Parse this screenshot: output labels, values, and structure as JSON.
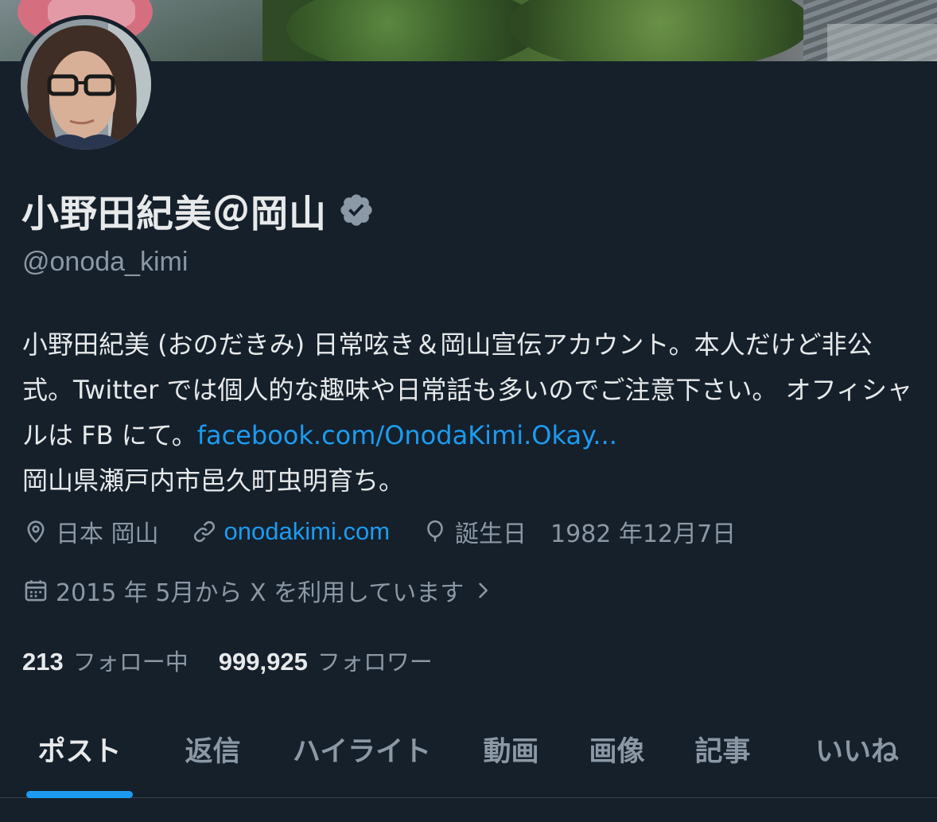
{
  "profile": {
    "display_name": "小野田紀美＠岡山",
    "handle": "@onoda_kimi",
    "verified_icon": "verified-badge-icon",
    "bio": {
      "text_part1": "小野田紀美 (おのだきみ) 日常呟き＆岡山宣伝アカウント。本人だけど非公式。Twitter では個人的な趣味や日常話も多いのでご注意下さい。 オフィシャルは FB にて。",
      "link": "facebook.com/OnodaKimi.Okay...",
      "text_part2": "岡山県瀬戸内市邑久町虫明育ち。"
    },
    "location": "日本 岡山",
    "location_icon": "location-pin-icon",
    "website": "onodakimi.com",
    "website_icon": "link-icon",
    "birthday_label": "誕生日",
    "birthday_value": "1982 年12月7日",
    "birthday_icon": "balloon-icon",
    "joined": "2015 年 5月から X を利用しています",
    "joined_icon": "calendar-icon",
    "following_count": "213",
    "following_label": "フォロー中",
    "followers_count": "999,925",
    "followers_label": "フォロワー"
  },
  "tabs": [
    {
      "label": "ポスト",
      "active": true
    },
    {
      "label": "返信",
      "active": false
    },
    {
      "label": "ハイライト",
      "active": false
    },
    {
      "label": "動画",
      "active": false
    },
    {
      "label": "画像",
      "active": false
    },
    {
      "label": "記事",
      "active": false
    },
    {
      "label": "いいね",
      "active": false
    }
  ],
  "colors": {
    "background": "#15202b",
    "text": "#e7e9ea",
    "secondary_text": "#8b98a5",
    "accent": "#1d9bf0",
    "verified_badge": "#8b98a5"
  }
}
